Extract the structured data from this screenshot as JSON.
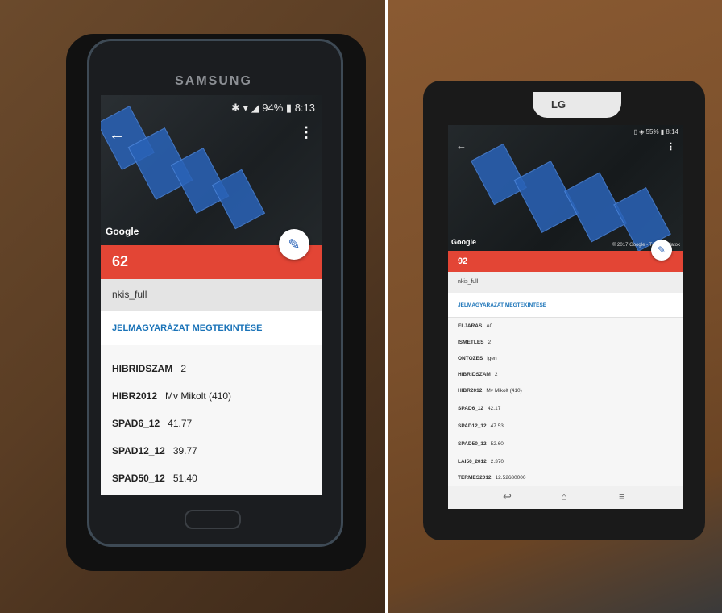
{
  "left_phone": {
    "brand": "SAMSUNG",
    "status": "✱ ▾ ◢ 94% ▮ 8:13",
    "back_icon": "←",
    "menu_icon": "⋮",
    "google": "Google",
    "edit_icon": "✎",
    "value": "62",
    "layer": "nkis_full",
    "legend_link": "JELMAGYARÁZAT MEGTEKINTÉSE",
    "rows": [
      {
        "key": "HIBRIDSZAM",
        "val": "2"
      },
      {
        "key": "HIBR2012",
        "val": "Mv Mikolt (410)"
      },
      {
        "key": "SPAD6_12",
        "val": "41.77"
      },
      {
        "key": "SPAD12_12",
        "val": "39.77"
      },
      {
        "key": "SPAD50_12",
        "val": "51.40"
      }
    ]
  },
  "right_tablet": {
    "brand": "LG",
    "status": "▯ ◈ 55% ▮ 8:14",
    "back_icon": "←",
    "menu_icon": "⋮",
    "google": "Google",
    "copyright": "© 2017 Google - Térkép adatok",
    "edit_icon": "✎",
    "value": "92",
    "layer": "nkis_full",
    "legend_link": "JELMAGYARÁZAT MEGTEKINTÉSE",
    "rows": [
      {
        "key": "ELJARAS",
        "val": "A0"
      },
      {
        "key": "ISMETLES",
        "val": "2"
      },
      {
        "key": "ONTOZES",
        "val": "igen"
      },
      {
        "key": "HIBRIDSZAM",
        "val": "2"
      },
      {
        "key": "HIBR2012",
        "val": "Mv Mikolt (410)"
      },
      {
        "key": "SPAD6_12",
        "val": "42.17"
      },
      {
        "key": "SPAD12_12",
        "val": "47.53"
      },
      {
        "key": "SPAD50_12",
        "val": "52.60"
      },
      {
        "key": "LAI50_2012",
        "val": "2.370"
      },
      {
        "key": "TERMES2012",
        "val": "12.52680000"
      }
    ],
    "nav": {
      "back": "↩",
      "home": "⌂",
      "recent": "≡"
    }
  }
}
